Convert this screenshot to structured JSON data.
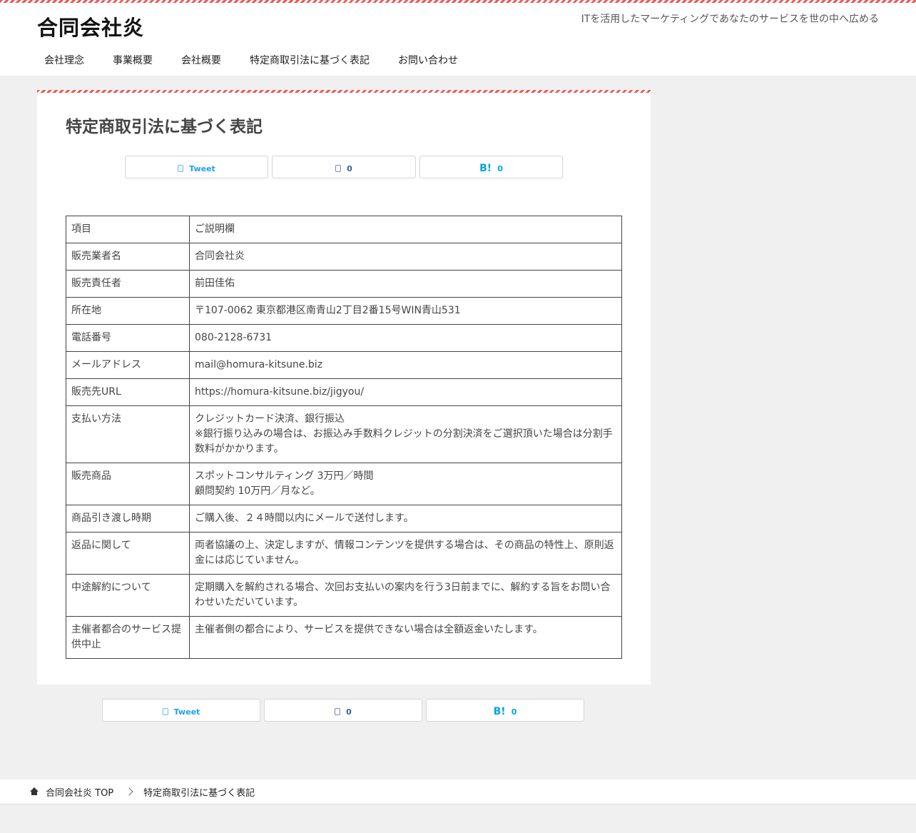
{
  "site": {
    "title": "合同会社炎",
    "tagline": "ITを活用したマーケティングであなたのサービスを世の中へ広める"
  },
  "nav": {
    "items": [
      {
        "label": "会社理念"
      },
      {
        "label": "事業概要"
      },
      {
        "label": "会社概要"
      },
      {
        "label": "特定商取引法に基づく表記"
      },
      {
        "label": "お問い合わせ"
      }
    ]
  },
  "page": {
    "title": "特定商取引法に基づく表記"
  },
  "share": {
    "tweet_label": "Tweet",
    "facebook_count": "0",
    "hatena_mark": "B!",
    "hatena_count": "0"
  },
  "table": {
    "rows": [
      {
        "key": "項目",
        "value": "ご説明欄"
      },
      {
        "key": "販売業者名",
        "value": "合同会社炎"
      },
      {
        "key": "販売責任者",
        "value": "前田佳佑"
      },
      {
        "key": "所在地",
        "value": "〒107-0062 東京都港区南青山2丁目2番15号WIN青山531"
      },
      {
        "key": "電話番号",
        "value": "080-2128-6731"
      },
      {
        "key": "メールアドレス",
        "value": "mail@homura-kitsune.biz"
      },
      {
        "key": "販売先URL",
        "value": "https://homura-kitsune.biz/jigyou/"
      },
      {
        "key": "支払い方法",
        "value": "クレジットカード決済、銀行振込\n※銀行振り込みの場合は、お振込み手数料クレジットの分割決済をご選択頂いた場合は分割手数料がかかります。"
      },
      {
        "key": "販売商品",
        "value": "スポットコンサルティング 3万円／時間\n顧問契約 10万円／月など。"
      },
      {
        "key": "商品引き渡し時期",
        "value": "ご購入後、２４時間以内にメールで送付します。"
      },
      {
        "key": "返品に関して",
        "value": "両者協議の上、決定しますが、情報コンテンツを提供する場合は、その商品の特性上、原則返金には応じていません。"
      },
      {
        "key": "中途解約について",
        "value": "定期購入を解約される場合、次回お支払いの案内を行う3日前までに、解約する旨をお問い合わせいただいています。"
      },
      {
        "key": "主催者都合のサービス提供中止",
        "value": "主催者側の都合により、サービスを提供できない場合は全額返金いたします。"
      }
    ]
  },
  "breadcrumb": {
    "home_label": "合同会社炎 TOP",
    "current_label": "特定商取引法に基づく表記"
  }
}
